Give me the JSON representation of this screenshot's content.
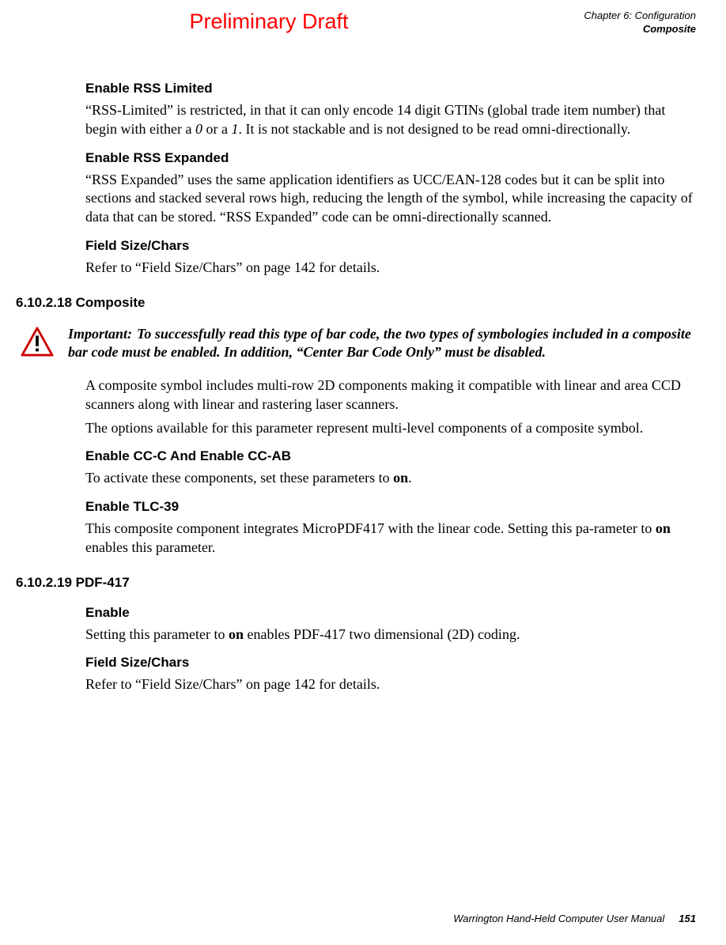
{
  "header": {
    "draft": "Preliminary Draft",
    "chapter": "Chapter 6:  Configuration",
    "section": "Composite"
  },
  "s1": {
    "h": "Enable RSS Limited",
    "p1a": "“RSS-Limited” is restricted, in that it can only encode 14 digit GTINs (global trade item number) that begin with either a ",
    "p1b": "0",
    "p1c": " or a ",
    "p1d": "1",
    "p1e": ". It is not stackable and is not designed to be read omni-directionally."
  },
  "s2": {
    "h": "Enable RSS Expanded",
    "p": "“RSS Expanded” uses the same application identifiers as UCC/EAN-128 codes but it can be split into sections and stacked several rows high, reducing the length of the symbol, while increasing the capacity of data that can be stored. “RSS Expanded” code can be omni-directionally scanned."
  },
  "s3": {
    "h": "Field Size/Chars",
    "p": "Refer to “Field Size/Chars” on page 142 for details."
  },
  "sec1": {
    "h": "6.10.2.18 Composite",
    "impLabel": "Important:",
    "impText": "To successfully read this type of bar code, the two types of symbologies included in a composite bar code must be enabled. In addition, “Center Bar Code Only” must be disabled.",
    "p1": "A composite symbol includes multi-row 2D components making it compatible with linear and area CCD scanners along with linear and rastering laser scanners.",
    "p2": "The options available for this parameter represent multi-level components of a composite symbol."
  },
  "s4": {
    "h": "Enable CC-C And Enable CC-AB",
    "p1a": "To activate these components, set these parameters to ",
    "p1b": "on",
    "p1c": "."
  },
  "s5": {
    "h": "Enable TLC-39",
    "p1a": "This composite component integrates MicroPDF417 with the linear code. Setting this pa-rameter to ",
    "p1b": "on",
    "p1c": " enables this parameter."
  },
  "sec2": {
    "h": "6.10.2.19 PDF-417"
  },
  "s6": {
    "h": "Enable",
    "p1a": "Setting this parameter to ",
    "p1b": "on",
    "p1c": " enables PDF-417 two dimensional (2D) coding."
  },
  "s7": {
    "h": "Field Size/Chars",
    "p": "Refer to “Field Size/Chars” on page 142 for details."
  },
  "footer": {
    "title": "Warrington Hand-Held Computer User Manual",
    "page": "151"
  }
}
